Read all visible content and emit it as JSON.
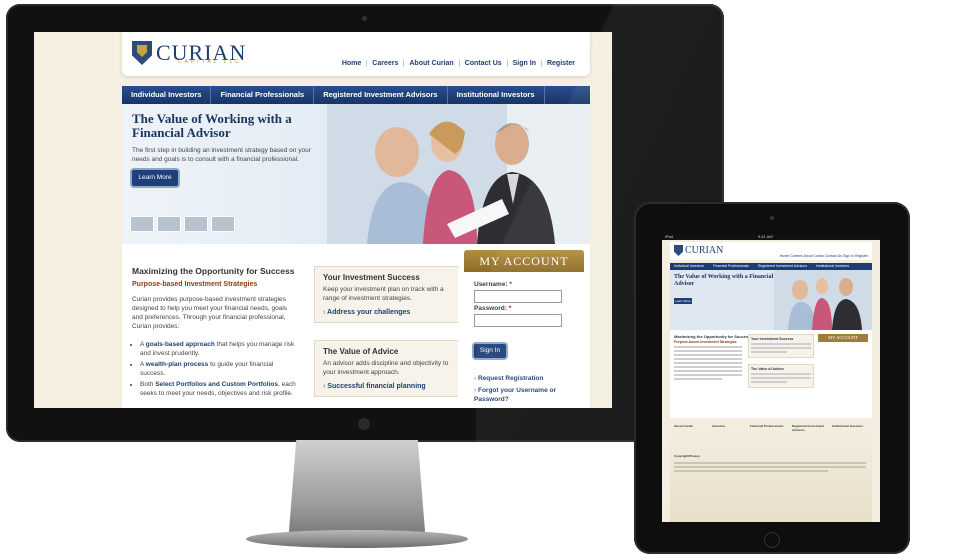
{
  "site": {
    "logo_text": "CURIAN",
    "logo_sub": "CAPITAL LLC",
    "top_nav": [
      "Home",
      "Careers",
      "About Curian",
      "Contact Us",
      "Sign In",
      "Register"
    ],
    "main_nav": [
      "Individual Investors",
      "Financial Professionals",
      "Registered Investment Advisors",
      "Institutional Investors"
    ],
    "hero": {
      "title": "The Value of Working with a Financial Advisor",
      "body": "The first step in building an investment strategy based on your needs and goals is to consult with a financial professional.",
      "button": "Learn More"
    },
    "left": {
      "title": "Maximizing the Opportunity for Success",
      "subtitle": "Purpose-based Investment Strategies",
      "body": "Curian provides purpose-based investment strategies designed to help you meet your financial needs, goals and preferences. Through your financial professional, Curian provides:",
      "list": [
        {
          "pre": "A ",
          "bold": "goals-based approach",
          "post": " that helps you manage risk and invest prudently."
        },
        {
          "pre": "A ",
          "bold": "wealth-plan process",
          "post": " to guide your financial success."
        },
        {
          "pre": "Both ",
          "bold": "Select Portfolios and Custom Portfolios",
          "post": ", each seeks to meet your needs, objectives and risk profile."
        }
      ]
    },
    "cards": [
      {
        "title": "Your Investment Success",
        "body": "Keep your investment plan on track with a range of investment strategies.",
        "link": "Address your challenges"
      },
      {
        "title": "The Value of Advice",
        "body": "An advisor adds discipline and objectivity to your investment approach.",
        "link": "Successful financial planning"
      }
    ],
    "account": {
      "header": "MY ACCOUNT",
      "username_label": "Username:",
      "password_label": "Password:",
      "required": "*",
      "sign_in": "Sign In",
      "links": [
        "Request Registration",
        "Forgot your Username or Password?"
      ]
    }
  },
  "tablet": {
    "status_left": "iPad",
    "status_center": "9:41 AM",
    "account_header": "MY ACCOUNT",
    "footer_cols": [
      "About Curian",
      "Investors",
      "Financial Professionals",
      "Registered Investment Advisors",
      "Institutional Investors"
    ],
    "footer_copyright": "Copyright/Privacy"
  }
}
